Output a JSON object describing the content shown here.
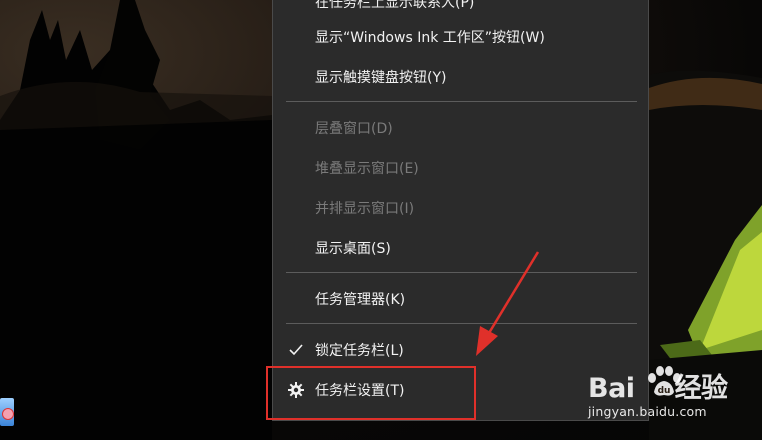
{
  "context_menu": {
    "items": [
      {
        "label": "在任务栏上显示联系人(P)",
        "enabled": true
      },
      {
        "label": "显示“Windows Ink 工作区”按钮(W)",
        "enabled": true
      },
      {
        "label": "显示触摸键盘按钮(Y)",
        "enabled": true
      },
      {
        "label": "层叠窗口(D)",
        "enabled": false
      },
      {
        "label": "堆叠显示窗口(E)",
        "enabled": false
      },
      {
        "label": "并排显示窗口(I)",
        "enabled": false
      },
      {
        "label": "显示桌面(S)",
        "enabled": true
      },
      {
        "label": "任务管理器(K)",
        "enabled": true
      },
      {
        "label": "锁定任务栏(L)",
        "enabled": true,
        "checked": true,
        "lead_icon": "check-icon"
      },
      {
        "label": "任务栏设置(T)",
        "enabled": true,
        "lead_icon": "gear-icon",
        "highlighted": true
      }
    ]
  },
  "annotation": {
    "highlight_color": "#e0302a",
    "arrow_color": "#e0302a"
  },
  "watermark": {
    "logo_text_left": "Bai",
    "logo_text_right": "经验",
    "site": "jingyan.baidu.com"
  },
  "colors": {
    "menu_bg": "#2b2b2b",
    "menu_text": "#f2f2f2",
    "menu_disabled_text": "#7a7a7a",
    "separator": "#5c5c5c"
  }
}
